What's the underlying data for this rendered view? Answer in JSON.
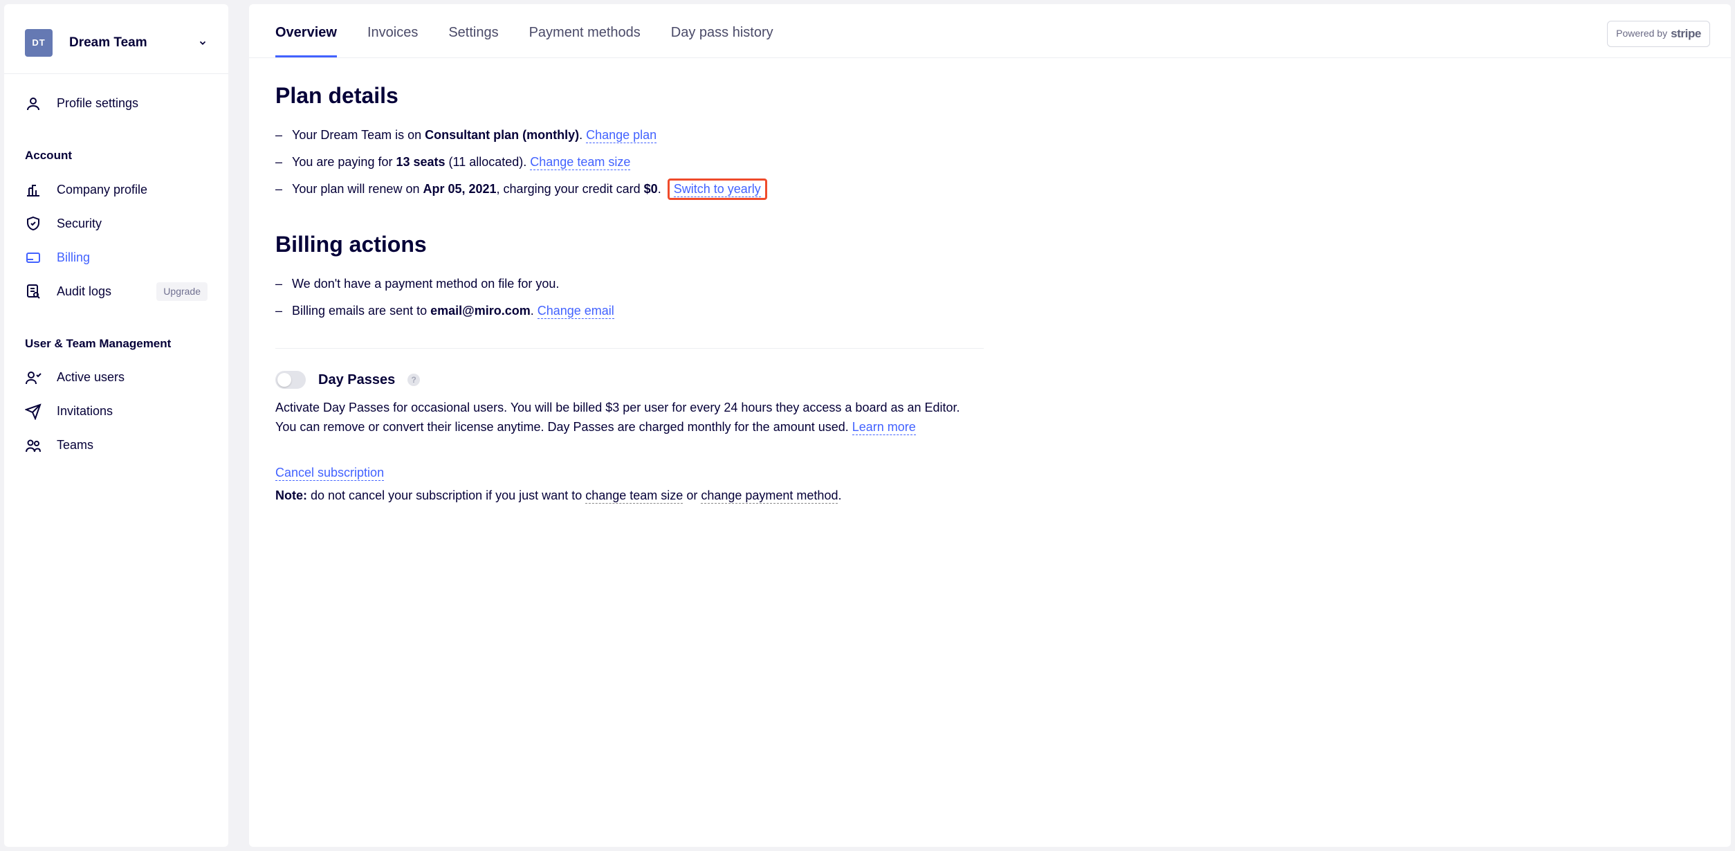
{
  "sidebar": {
    "team_initials": "DT",
    "team_name": "Dream Team",
    "profile_label": "Profile settings",
    "account_heading": "Account",
    "account_items": [
      {
        "label": "Company profile"
      },
      {
        "label": "Security"
      },
      {
        "label": "Billing"
      },
      {
        "label": "Audit logs"
      }
    ],
    "upgrade_badge": "Upgrade",
    "user_mgmt_heading": "User & Team Management",
    "user_items": [
      {
        "label": "Active users"
      },
      {
        "label": "Invitations"
      },
      {
        "label": "Teams"
      }
    ]
  },
  "tabs": {
    "overview": "Overview",
    "invoices": "Invoices",
    "settings": "Settings",
    "payment_methods": "Payment methods",
    "day_pass_history": "Day pass history"
  },
  "stripe": {
    "powered_by": "Powered by",
    "brand": "stripe"
  },
  "plan_details": {
    "heading": "Plan details",
    "line1_prefix": "Your Dream Team is on ",
    "line1_plan": "Consultant plan (monthly)",
    "line1_suffix": ". ",
    "change_plan": "Change plan",
    "line2_prefix": "You are paying for ",
    "line2_seats": "13 seats",
    "line2_allocated": " (11 allocated). ",
    "change_team_size": "Change team size",
    "line3_prefix": "Your plan will renew on ",
    "line3_date": "Apr 05, 2021",
    "line3_mid": ", charging your credit card ",
    "line3_amount": "$0",
    "line3_dot": ". ",
    "switch_to_yearly": "Switch to yearly"
  },
  "billing_actions": {
    "heading": "Billing actions",
    "line1": "We don't have a payment method on file for you.",
    "line2_prefix": "Billing emails are sent to ",
    "line2_email": "email@miro.com",
    "line2_dot": ". ",
    "change_email": "Change email"
  },
  "day_passes": {
    "title": "Day Passes",
    "help": "?",
    "body1": "Activate Day Passes for occasional users. You will be billed $3 per user for every 24 hours they access a board as an Editor.",
    "body2_prefix": "You can remove or convert their license anytime. Day Passes are charged monthly for the amount used. ",
    "learn_more": "Learn more"
  },
  "cancel": {
    "cancel_link": "Cancel subscription",
    "note_label": "Note:",
    "note_prefix": " do not cancel your subscription if you just want to ",
    "change_team_size": "change team size",
    "or": " or ",
    "change_payment": "change payment method",
    "dot": "."
  }
}
